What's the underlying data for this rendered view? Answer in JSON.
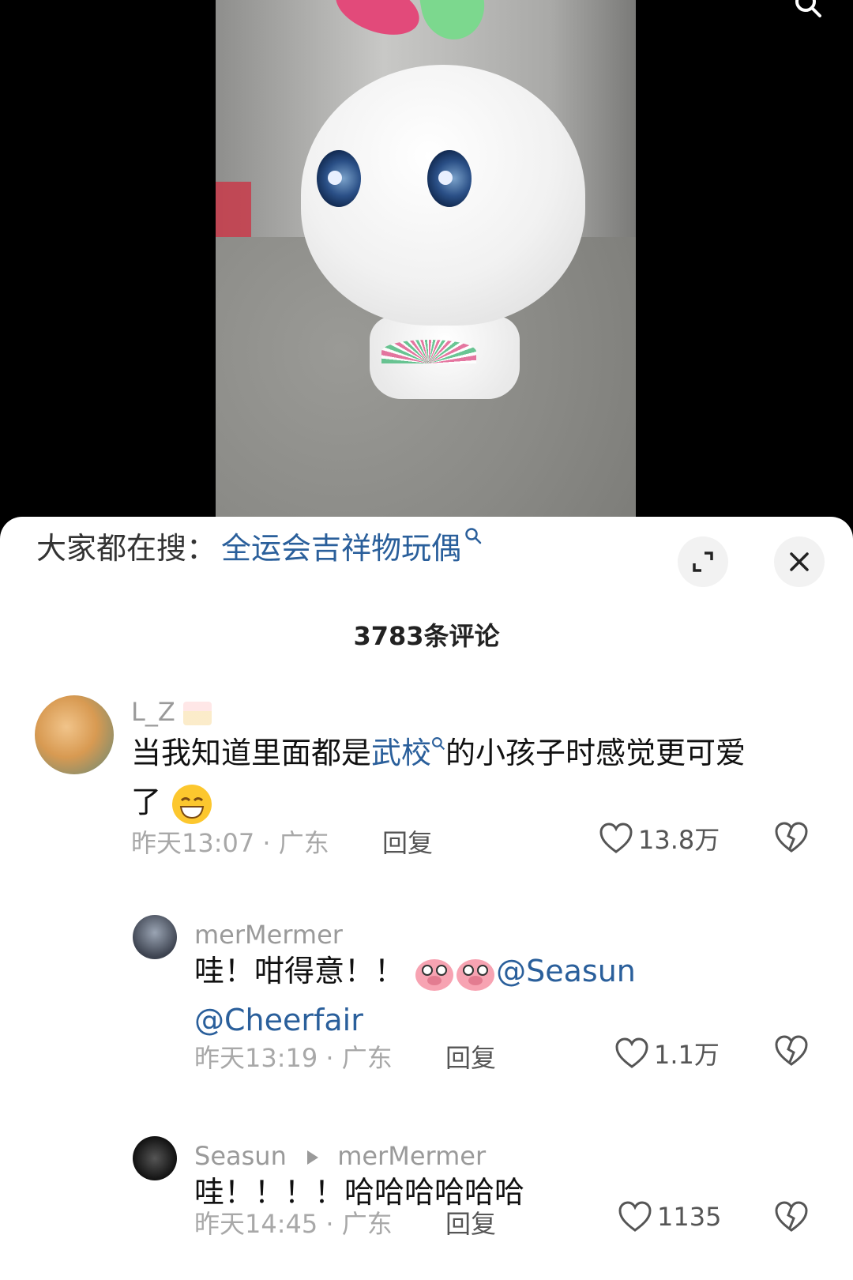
{
  "hot_search": {
    "prefix": "大家都在搜：",
    "term": "全运会吉祥物玩偶"
  },
  "comment_count": "3783条评论",
  "comments": [
    {
      "username": "L_Z",
      "text_before": "当我知道里面都是",
      "link": "武校",
      "text_after": "的小孩子时感觉更可爱",
      "text_line2": "了",
      "meta": "昨天13:07 · 广东",
      "reply_label": "回复",
      "likes": "13.8万"
    },
    {
      "username": "merMermer",
      "text": "哇！咁得意！！",
      "mention1": "@Seasun",
      "mention2": "@Cheerfair",
      "meta": "昨天13:19 · 广东",
      "reply_label": "回复",
      "likes": "1.1万"
    },
    {
      "username": "Seasun",
      "reply_to": "merMermer",
      "text": "哇！！！！哈哈哈哈哈哈",
      "meta": "昨天14:45 · 广东",
      "reply_label": "回复",
      "likes": "1135"
    }
  ],
  "colors": {
    "link": "#2a5f9b",
    "meta": "#a8a8a8"
  }
}
